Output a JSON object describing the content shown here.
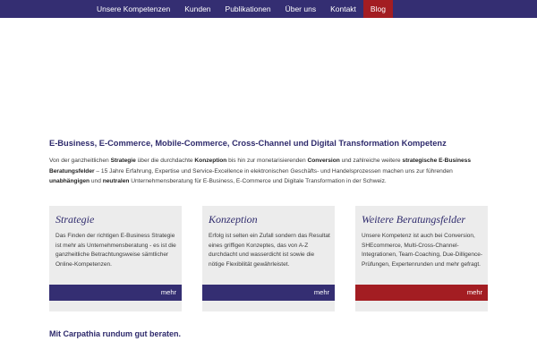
{
  "nav": {
    "items": [
      {
        "label": "Unsere Kompetenzen"
      },
      {
        "label": "Kunden"
      },
      {
        "label": "Publikationen"
      },
      {
        "label": "Über uns"
      },
      {
        "label": "Kontakt"
      },
      {
        "label": "Blog"
      }
    ]
  },
  "headline": "E-Business, E-Commerce, Mobile-Commerce, Cross-Channel und Digital Transformation Kompetenz",
  "intro": {
    "p1": "Von der ganzheitlichen ",
    "b1": "Strategie",
    "p2": " über die durchdachte ",
    "b2": "Konzeption",
    "p3": " bis hin zur monetarisierenden ",
    "b3": "Conversion",
    "p4": " und zahlreiche weitere ",
    "b4": "strategische E-Business Beratungsfelder",
    "p5": " – 15 Jahre Erfahrung, Expertise und Service-Excellence in elektronischen Geschäfts- und Handelsprozessen machen uns zur führenden ",
    "b5": "unabhängigen",
    "p6": " und ",
    "b6": "neutralen",
    "p7": " Unternehmensberatung für E-Business, E-Commerce und Digitale Transformation in der Schweiz."
  },
  "cards": [
    {
      "title": "Strategie",
      "text": "Das Finden der richtigen E-Business Strategie ist mehr als Unternehmensberatung - es ist die ganzheitliche Betrachtungsweise sämtlicher Online-Kompetenzen.",
      "more": "mehr"
    },
    {
      "title": "Konzeption",
      "text": "Erfolg ist selten ein Zufall sondern das Resultat eines griffigen Konzeptes, das von A-Z durchdacht und wasserdicht ist sowie die nötige Flexibilität gewährleistet.",
      "more": "mehr"
    },
    {
      "title": "Weitere Beratungsfelder",
      "text": "Unsere Kompetenz ist auch bei Conversion, SHEcommerce, Multi-Cross-Channel-Integrationen, Team-Coaching, Due-Dilligence-Prüfungen, Expertenrunden und mehr gefragt.",
      "more": "mehr"
    }
  ],
  "tagline": "Mit Carpathia rundum gut beraten.",
  "colors": {
    "primary": "#342e72",
    "accent": "#a31d22",
    "card_bg": "#ececec"
  }
}
